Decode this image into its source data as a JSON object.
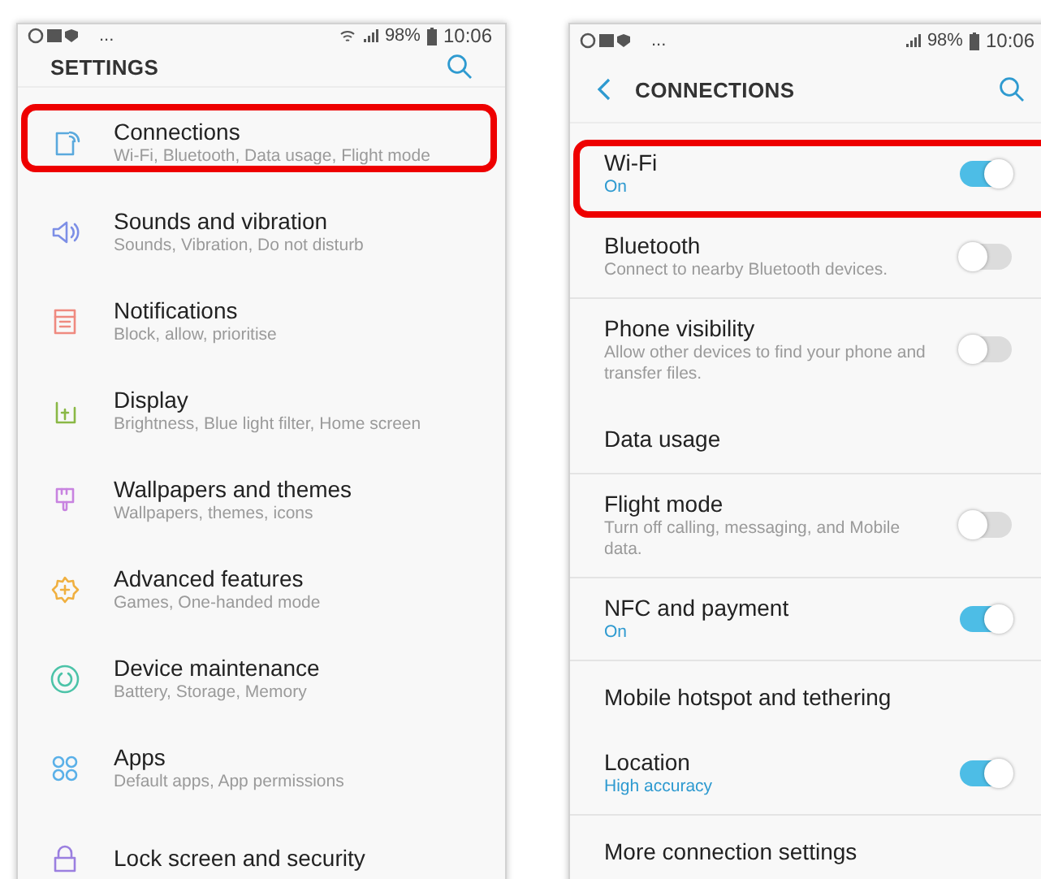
{
  "screens": [
    {
      "status_bar": {
        "left": "...",
        "battery": "98%",
        "time": "10:06"
      },
      "header": {
        "title": "SETTINGS",
        "back": false
      },
      "items": [
        {
          "title": "Connections",
          "subtitle": "Wi-Fi, Bluetooth, Data usage, Flight mode",
          "highlighted": true
        },
        {
          "title": "Sounds and vibration",
          "subtitle": "Sounds, Vibration, Do not disturb",
          "highlighted": false
        },
        {
          "title": "Notifications",
          "subtitle": "Block, allow, prioritise",
          "highlighted": false
        },
        {
          "title": "Display",
          "subtitle": "Brightness, Blue light filter, Home screen",
          "highlighted": false
        },
        {
          "title": "Wallpapers and themes",
          "subtitle": "Wallpapers, themes, icons",
          "highlighted": false
        },
        {
          "title": "Advanced features",
          "subtitle": "Games, One-handed mode",
          "highlighted": false
        },
        {
          "title": "Device maintenance",
          "subtitle": "Battery, Storage, Memory",
          "highlighted": false
        },
        {
          "title": "Apps",
          "subtitle": "Default apps, App permissions",
          "highlighted": false
        },
        {
          "title": "Lock screen and security",
          "highlighted": false
        }
      ]
    },
    {
      "status_bar": {
        "left": "...",
        "battery": "98%",
        "time": "10:06"
      },
      "header": {
        "title": "CONNECTIONS",
        "back": true
      },
      "items": [
        {
          "title": "Wi-Fi",
          "status": "On",
          "on": true,
          "highlighted": true,
          "divider": false
        },
        {
          "title": "Bluetooth",
          "subtitle": "Connect to nearby Bluetooth devices.",
          "on": false,
          "highlighted": false,
          "divider": true
        },
        {
          "title": "Phone visibility",
          "subtitle": "Allow other devices to find your phone and transfer files.",
          "on": false,
          "highlighted": false,
          "divider": false
        },
        {
          "title": "Data usage",
          "highlighted": false,
          "divider": true
        },
        {
          "title": "Flight mode",
          "subtitle": "Turn off calling, messaging, and Mobile data.",
          "on": false,
          "highlighted": false,
          "divider": true
        },
        {
          "title": "NFC and payment",
          "status": "On",
          "on": true,
          "highlighted": false,
          "divider": true
        },
        {
          "title": "Mobile hotspot and tethering",
          "highlighted": false,
          "divider": false
        },
        {
          "title": "Location",
          "status": "High accuracy",
          "on": true,
          "highlighted": false,
          "divider": true
        },
        {
          "title": "More connection settings",
          "highlighted": false,
          "divider": false
        }
      ]
    }
  ]
}
